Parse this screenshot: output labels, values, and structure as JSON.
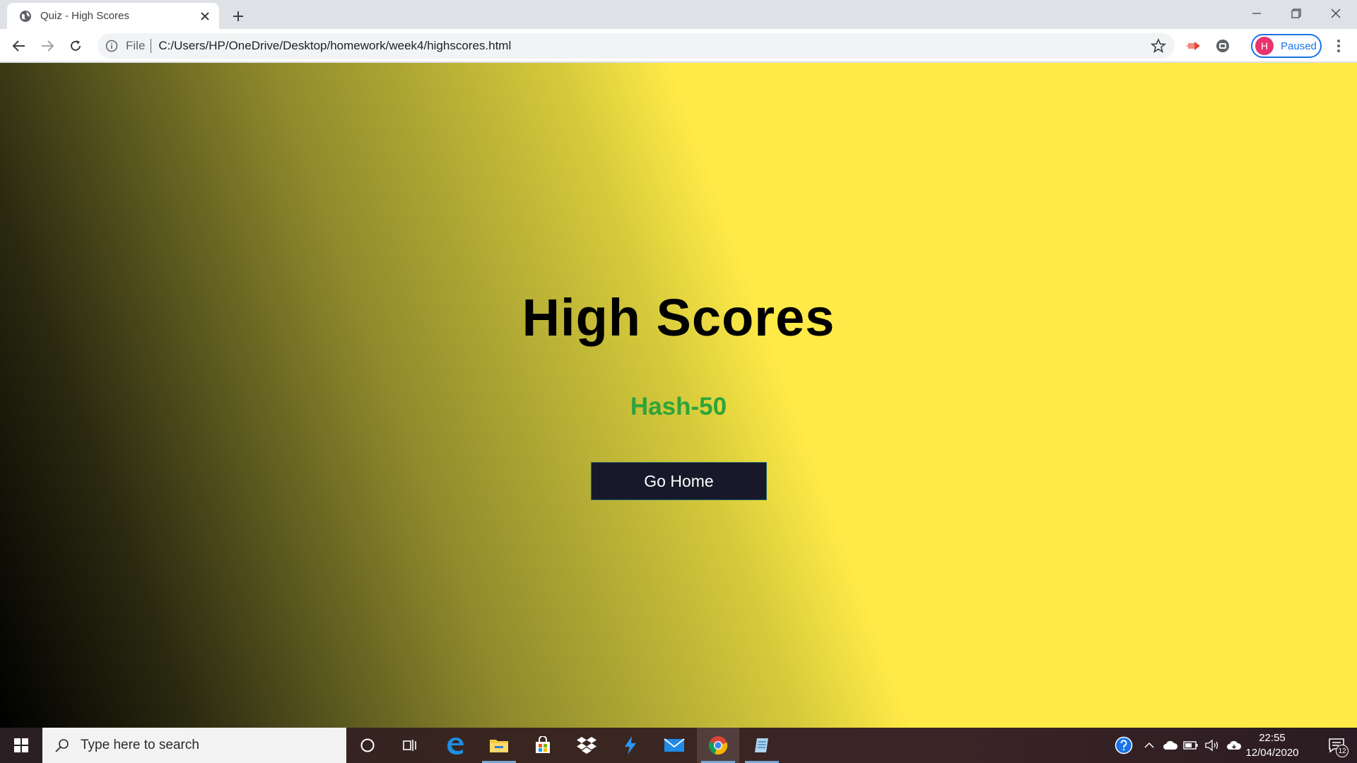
{
  "browser": {
    "tab": {
      "title": "Quiz - High Scores",
      "favicon": "globe-icon"
    },
    "address": {
      "scheme": "File",
      "url": "C:/Users/HP/OneDrive/Desktop/homework/week4/highscores.html"
    },
    "profile": {
      "initial": "H",
      "status": "Paused",
      "avatar_color": "#e8336d",
      "accent": "#1a73e8"
    }
  },
  "page": {
    "title": "High Scores",
    "score_entry": "Hash-50",
    "score_color": "#2ea43b",
    "go_home_label": "Go Home",
    "background_gradient": [
      "#000000",
      "#ffea47"
    ]
  },
  "taskbar": {
    "search_placeholder": "Type here to search",
    "time": "22:55",
    "date": "12/04/2020",
    "notification_count": "12",
    "pinned": [
      "cortana-icon",
      "task-view-icon",
      "edge-icon",
      "file-explorer-icon",
      "store-icon",
      "dropbox-icon",
      "visual-studio-icon",
      "mail-icon",
      "chrome-icon",
      "notepad-icon"
    ]
  }
}
